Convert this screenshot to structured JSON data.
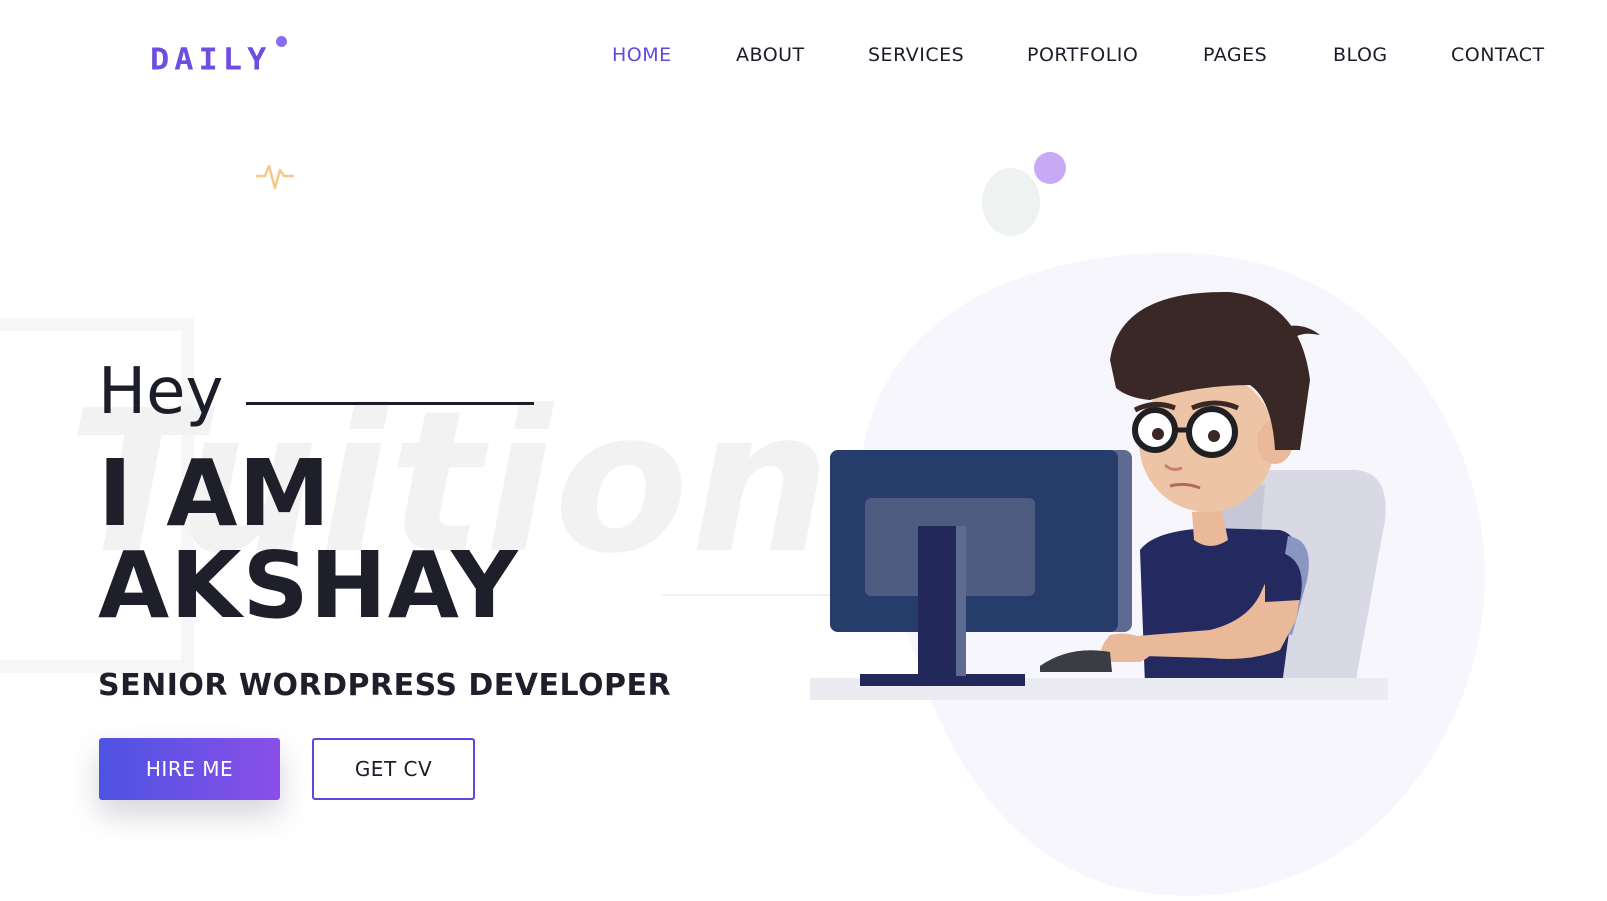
{
  "header": {
    "logo_text": "DAILY",
    "nav": [
      {
        "label": "HOME",
        "active": true
      },
      {
        "label": "ABOUT",
        "active": false
      },
      {
        "label": "SERVICES",
        "active": false
      },
      {
        "label": "PORTFOLIO",
        "active": false
      },
      {
        "label": "PAGES",
        "active": false
      },
      {
        "label": "BLOG",
        "active": false
      },
      {
        "label": "CONTACT",
        "active": false
      }
    ]
  },
  "hero": {
    "greeting": "Hey",
    "name_line1": "I AM",
    "name_line2": "AKSHAY",
    "role": "SENIOR WORDPRESS DEVELOPER",
    "background_word": "Tuition",
    "buttons": {
      "hire": "HIRE ME",
      "cv": "GET CV"
    },
    "illustration_icon": "developer-at-computer-illustration"
  },
  "colors": {
    "brand": "#5d49e4",
    "logo": "#6d4ee0",
    "text": "#1b1d2a",
    "button_gradient_start": "#4d53e1",
    "button_gradient_end": "#8a4fe9",
    "pulse_accent": "#f5c98a",
    "blob": "#f7f6fd"
  }
}
